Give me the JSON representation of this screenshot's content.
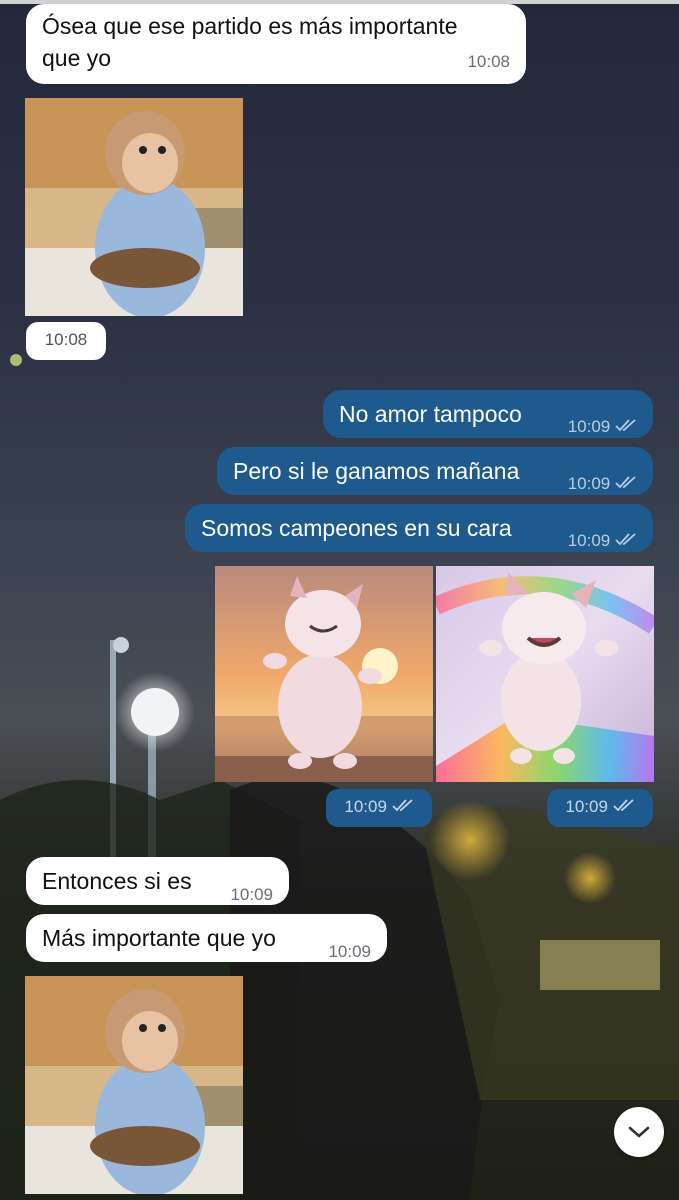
{
  "messages": {
    "m1": {
      "text_line1": "Ósea que ese partido es más importante",
      "text_line2": "que yo",
      "time": "10:08"
    },
    "sticker1": {
      "time": "10:08",
      "icon": "monkey-sticker"
    },
    "m2": {
      "text": "No amor tampoco",
      "time": "10:09"
    },
    "m3": {
      "text": "Pero si le ganamos mañana",
      "time": "10:09"
    },
    "m4": {
      "text": "Somos campeones en su cara",
      "time": "10:09"
    },
    "photo1": {
      "time": "10:09",
      "icon": "dog-sunset-image"
    },
    "photo2": {
      "time": "10:09",
      "icon": "dog-rainbow-image"
    },
    "m5": {
      "text": "Entonces si es",
      "time": "10:09"
    },
    "m6": {
      "text": "Más importante que yo",
      "time": "10:09"
    },
    "sticker2": {
      "icon": "monkey-sticker"
    }
  },
  "colors": {
    "incoming": "#ffffff",
    "outgoing": "#1f5a8f"
  },
  "scroll_button": {
    "icon": "chevron-down-icon"
  }
}
